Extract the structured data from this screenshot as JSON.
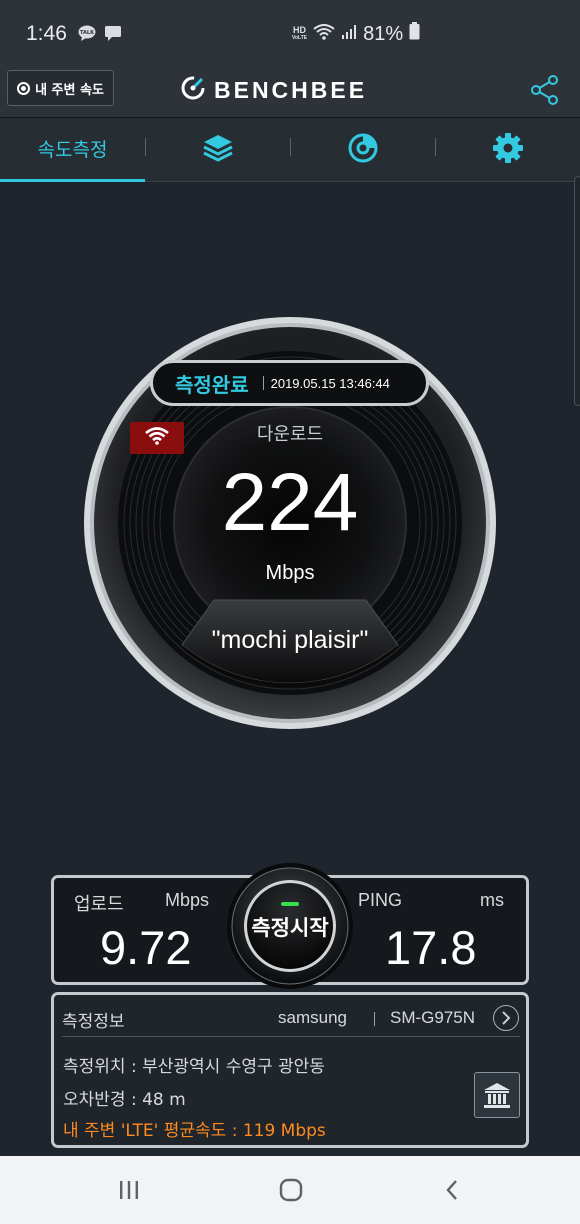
{
  "status_bar": {
    "time": "1:46",
    "hd_top": "HD",
    "hd_bottom": "VoLTE",
    "battery": "81%"
  },
  "header": {
    "nearby_button": "내 주변 속도",
    "logo": "BENCHBEE"
  },
  "tabs": {
    "speed_test": "속도측정"
  },
  "gauge": {
    "status": "측정완료",
    "datetime": "2019.05.15 13:46:44",
    "label": "다운로드",
    "value": "224",
    "unit": "Mbps",
    "ssid": "\"mochi plaisir\""
  },
  "results": {
    "upload_label": "업로드",
    "upload_unit": "Mbps",
    "upload_value": "9.72",
    "ping_label": "PING",
    "ping_unit": "ms",
    "ping_value": "17.8",
    "start_button": "측정시작"
  },
  "info": {
    "title": "측정정보",
    "brand": "samsung",
    "model": "SM-G975N",
    "location": "측정위치 : 부산광역시  수영구 광안동",
    "error_radius": "오차반경 : 48 m",
    "nearby_average": "내 주변 'LTE' 평균속도 :  119 Mbps"
  },
  "colors": {
    "accent": "#33c9e0",
    "highlight": "#ff8a1f",
    "wifi_badge": "#8b0e0e",
    "background": "#1f252c"
  },
  "icons": [
    "talk-icon",
    "message-icon",
    "wifi-icon",
    "signal-icon",
    "battery-icon",
    "location-dot-icon",
    "speedometer-logo-icon",
    "share-icon",
    "layers-icon",
    "history-chart-icon",
    "gear-icon",
    "chevron-right-icon",
    "government-building-icon",
    "recent-apps-icon",
    "home-icon",
    "back-icon"
  ]
}
